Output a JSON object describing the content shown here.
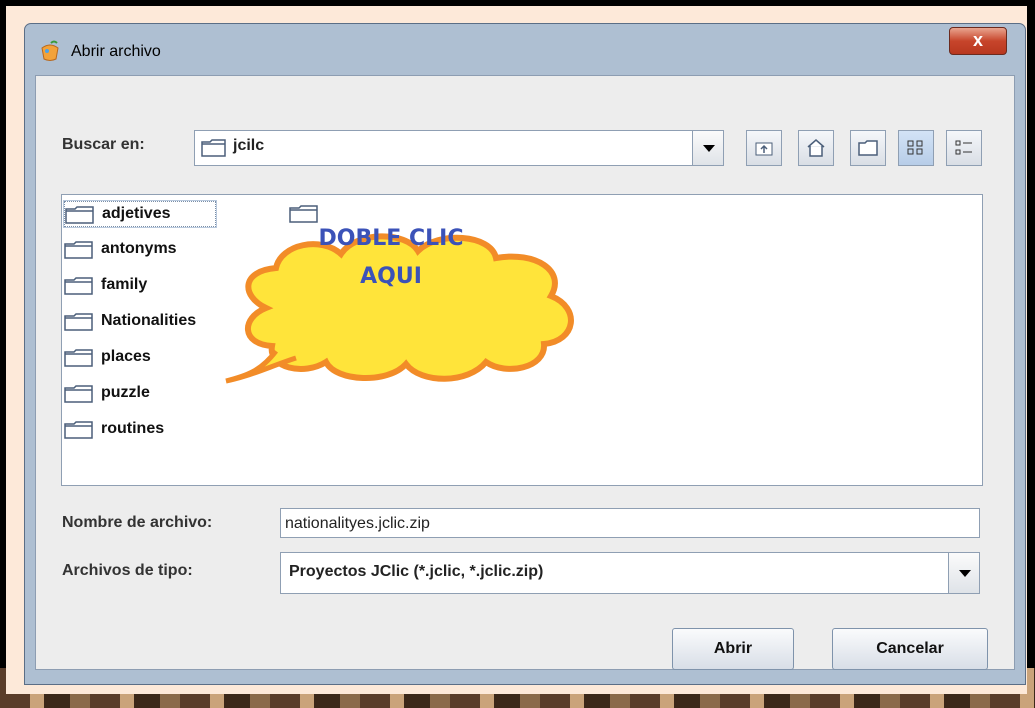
{
  "window": {
    "title": "Abrir archivo",
    "close_label": "x"
  },
  "toolbar": {
    "look_in_label": "Buscar en:",
    "look_in_value": "jcilc",
    "buttons": [
      "up-folder-icon",
      "home-icon",
      "new-folder-icon",
      "list-view-icon",
      "details-view-icon"
    ]
  },
  "files": [
    {
      "label": "adjetives",
      "selected": true
    },
    {
      "label": "antonyms"
    },
    {
      "label": "family"
    },
    {
      "label": "Nationalities"
    },
    {
      "label": "places"
    },
    {
      "label": "puzzle"
    },
    {
      "label": "routines"
    }
  ],
  "overlay": {
    "line1": "DOBLE CLIC",
    "line2": "AQUI"
  },
  "filename": {
    "label": "Nombre de archivo:",
    "value": "nationalityes.jclic.zip"
  },
  "filetype": {
    "label": "Archivos de tipo:",
    "value": "Proyectos JClic (*.jclic, *.jclic.zip)"
  },
  "actions": {
    "open": "Abrir",
    "cancel": "Cancelar"
  },
  "colors": {
    "cloud_fill": "#ffe43a",
    "cloud_stroke": "#f28c28",
    "cloud_text": "#3b52b8",
    "close_button": "#c7452b"
  }
}
